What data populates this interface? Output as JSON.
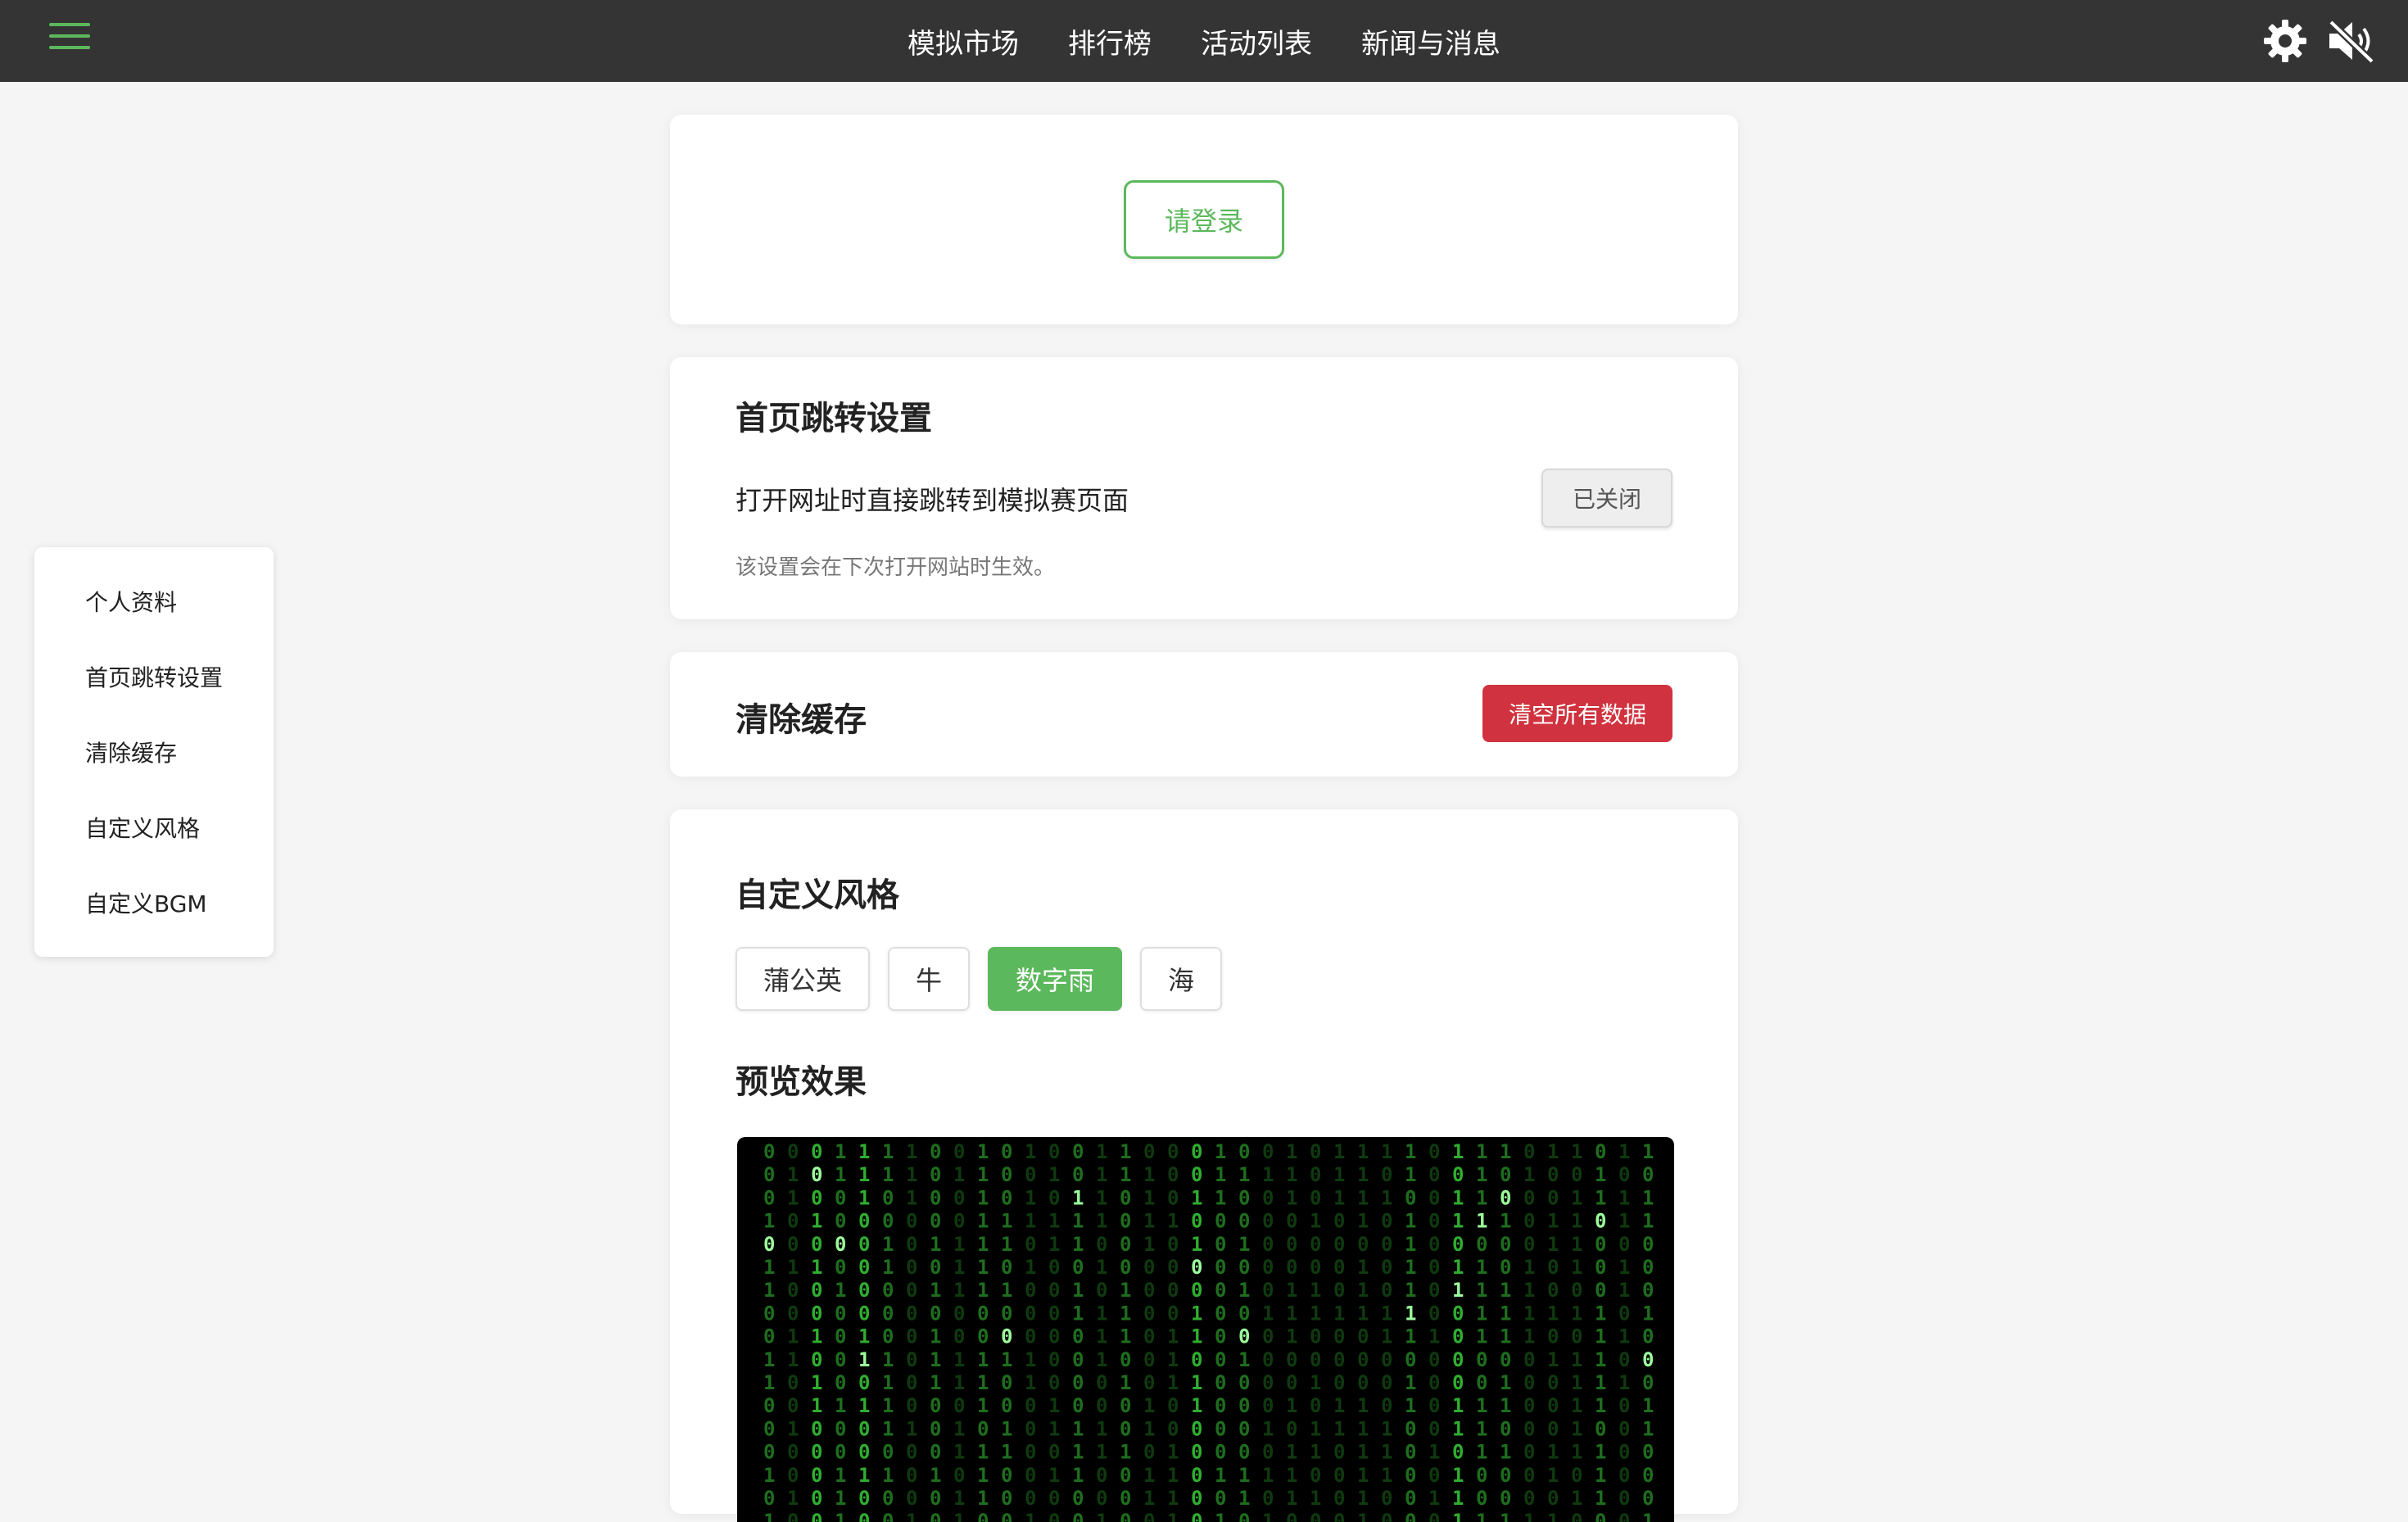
{
  "navbar": {
    "links": [
      "模拟市场",
      "排行榜",
      "活动列表",
      "新闻与消息"
    ],
    "accent_color": "#5cb85c",
    "icons": [
      "menu-icon",
      "gear-icon",
      "mute-icon"
    ]
  },
  "sidebar": {
    "items": [
      {
        "label": "个人资料"
      },
      {
        "label": "首页跳转设置"
      },
      {
        "label": "清除缓存"
      },
      {
        "label": "自定义风格"
      },
      {
        "label": "自定义BGM"
      }
    ]
  },
  "login": {
    "button_label": "请登录"
  },
  "redirect": {
    "title": "首页跳转设置",
    "label": "打开网址时直接跳转到模拟赛页面",
    "toggle_label": "已关闭",
    "note": "该设置会在下次打开网站时生效。"
  },
  "cache": {
    "title": "清除缓存",
    "button_label": "清空所有数据",
    "button_color": "#d0333f"
  },
  "style": {
    "title": "自定义风格",
    "themes": [
      "蒲公英",
      "牛",
      "数字雨",
      "海"
    ],
    "selected_theme": "数字雨",
    "preview_title": "预览效果"
  }
}
